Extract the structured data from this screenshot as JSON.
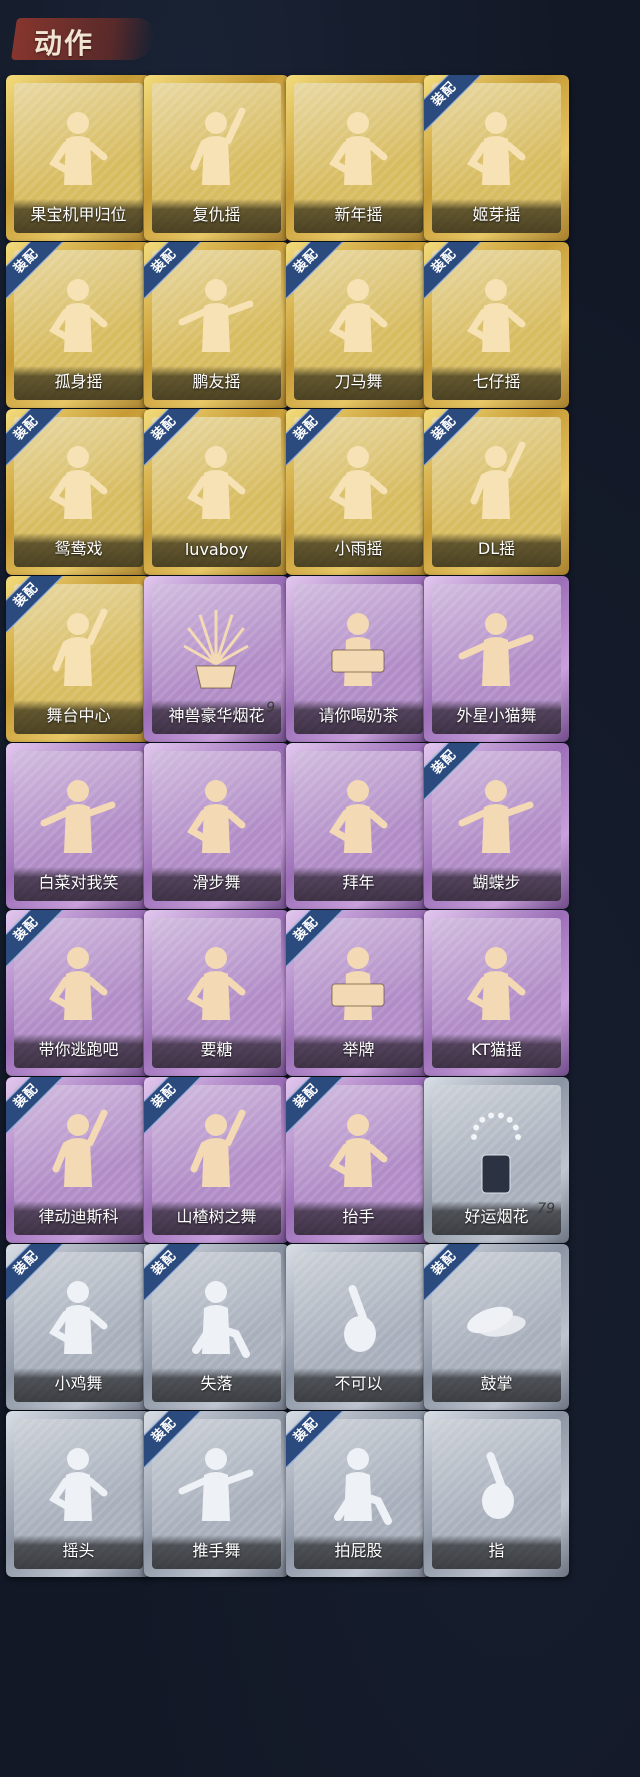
{
  "header": {
    "title": "动作"
  },
  "badge_label": "装配",
  "colors": {
    "gold": "#d5b857",
    "purple": "#ad86c4",
    "silver": "#a4acb9",
    "badge": "#2b4a7e"
  },
  "items": [
    {
      "name": "果宝机甲归位",
      "rarity": "gold",
      "equipped": false,
      "icon": "figure-dance-icon"
    },
    {
      "name": "复仇摇",
      "rarity": "gold",
      "equipped": false,
      "icon": "figure-point-up-icon"
    },
    {
      "name": "新年摇",
      "rarity": "gold",
      "equipped": false,
      "icon": "figure-wave-icon"
    },
    {
      "name": "姬芽摇",
      "rarity": "gold",
      "equipped": true,
      "icon": "figure-hand-wave-icon"
    },
    {
      "name": "孤身摇",
      "rarity": "gold",
      "equipped": true,
      "icon": "figure-dance-icon"
    },
    {
      "name": "鹏友摇",
      "rarity": "gold",
      "equipped": true,
      "icon": "figure-arms-out-icon"
    },
    {
      "name": "刀马舞",
      "rarity": "gold",
      "equipped": true,
      "icon": "figure-dance-icon"
    },
    {
      "name": "七仔摇",
      "rarity": "gold",
      "equipped": true,
      "icon": "figure-flex-icon"
    },
    {
      "name": "鸳鸯戏",
      "rarity": "gold",
      "equipped": true,
      "icon": "figure-dance-icon"
    },
    {
      "name": "luvaboy",
      "rarity": "gold",
      "equipped": true,
      "icon": "figure-cross-arms-icon"
    },
    {
      "name": "小雨摇",
      "rarity": "gold",
      "equipped": true,
      "icon": "figure-dance-icon"
    },
    {
      "name": "DL摇",
      "rarity": "gold",
      "equipped": true,
      "icon": "figure-arm-up-icon"
    },
    {
      "name": "舞台中心",
      "rarity": "gold",
      "equipped": true,
      "icon": "figure-point-up-icon"
    },
    {
      "name": "神兽豪华烟花",
      "rarity": "purple",
      "equipped": false,
      "icon": "fireworks-pot-icon",
      "count": "9"
    },
    {
      "name": "请你喝奶茶",
      "rarity": "purple",
      "equipped": false,
      "icon": "figure-sign-icon"
    },
    {
      "name": "外星小猫舞",
      "rarity": "purple",
      "equipped": false,
      "icon": "figure-arms-out-icon"
    },
    {
      "name": "白菜对我笑",
      "rarity": "purple",
      "equipped": false,
      "icon": "figure-arms-out-icon"
    },
    {
      "name": "滑步舞",
      "rarity": "purple",
      "equipped": false,
      "icon": "figure-dance-icon"
    },
    {
      "name": "拜年",
      "rarity": "purple",
      "equipped": false,
      "icon": "figure-bow-icon"
    },
    {
      "name": "蝴蝶步",
      "rarity": "purple",
      "equipped": true,
      "icon": "figure-arms-out-icon"
    },
    {
      "name": "带你逃跑吧",
      "rarity": "purple",
      "equipped": true,
      "icon": "figure-run-icon"
    },
    {
      "name": "要糖",
      "rarity": "purple",
      "equipped": false,
      "icon": "figure-reach-icon"
    },
    {
      "name": "举牌",
      "rarity": "purple",
      "equipped": true,
      "icon": "figure-sign-icon"
    },
    {
      "name": "KT猫摇",
      "rarity": "purple",
      "equipped": false,
      "icon": "figure-dance-icon"
    },
    {
      "name": "律动迪斯科",
      "rarity": "purple",
      "equipped": true,
      "icon": "figure-arm-up-icon"
    },
    {
      "name": "山楂树之舞",
      "rarity": "purple",
      "equipped": true,
      "icon": "figure-arm-up-icon"
    },
    {
      "name": "抬手",
      "rarity": "purple",
      "equipped": true,
      "icon": "figure-reach-icon"
    },
    {
      "name": "好运烟花",
      "rarity": "silver",
      "equipped": false,
      "icon": "firework-can-icon",
      "count": "79"
    },
    {
      "name": "小鸡舞",
      "rarity": "silver",
      "equipped": true,
      "icon": "figure-dance-icon"
    },
    {
      "name": "失落",
      "rarity": "silver",
      "equipped": true,
      "icon": "figure-crawl-icon"
    },
    {
      "name": "不可以",
      "rarity": "silver",
      "equipped": false,
      "icon": "finger-no-icon"
    },
    {
      "name": "鼓掌",
      "rarity": "silver",
      "equipped": true,
      "icon": "clap-hands-icon"
    },
    {
      "name": "摇头",
      "rarity": "silver",
      "equipped": false,
      "icon": "figure-shake-head-icon"
    },
    {
      "name": "推手舞",
      "rarity": "silver",
      "equipped": true,
      "icon": "figure-push-icon"
    },
    {
      "name": "拍屁股",
      "rarity": "silver",
      "equipped": true,
      "icon": "figure-bend-icon"
    },
    {
      "name": "指",
      "rarity": "silver",
      "equipped": false,
      "icon": "pointing-hand-icon"
    }
  ]
}
